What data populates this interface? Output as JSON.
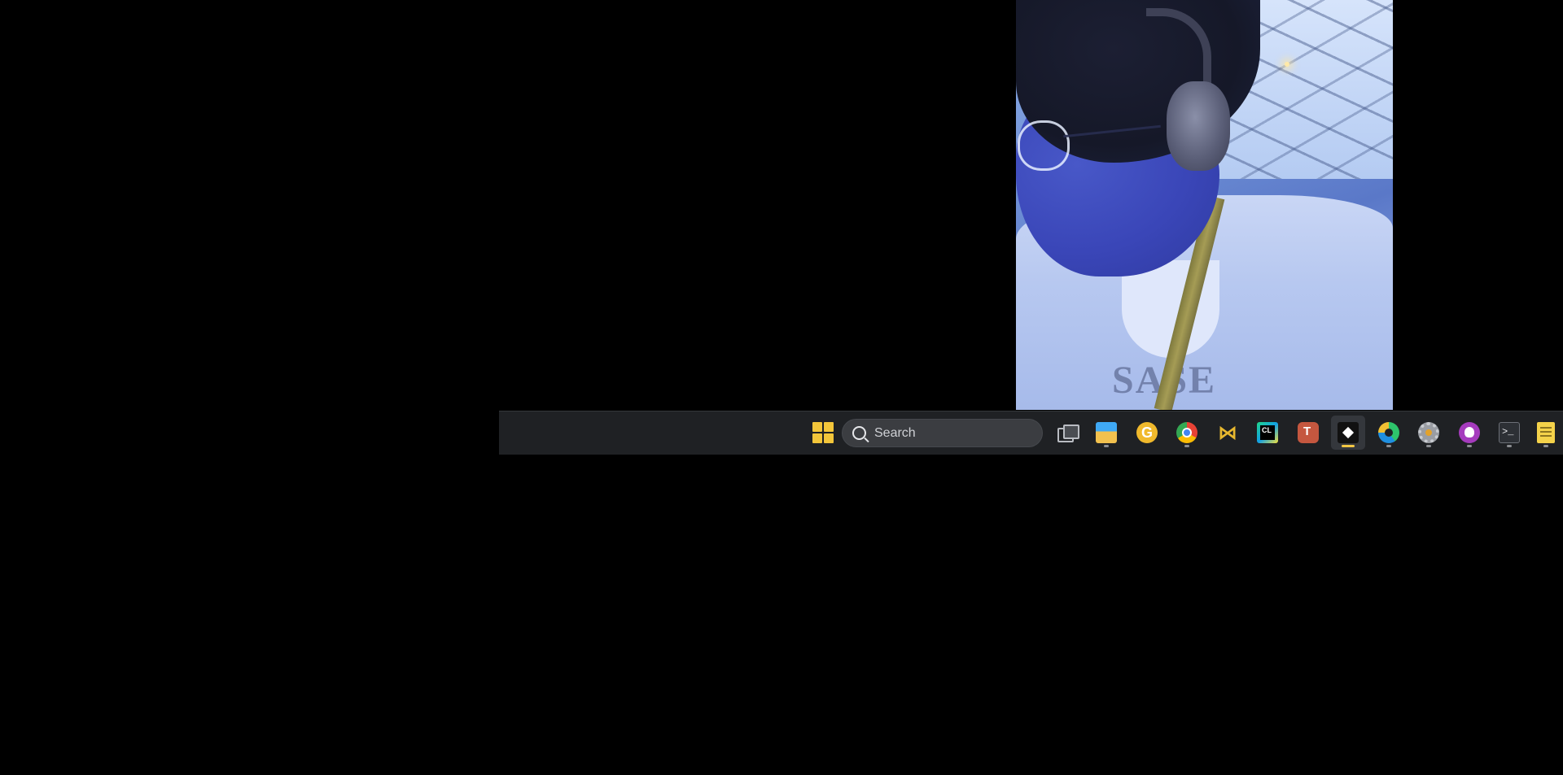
{
  "taskbar": {
    "search": {
      "placeholder": "Search"
    },
    "pinned": [
      {
        "name": "start",
        "icon": "windows-start-icon"
      },
      {
        "name": "task-view",
        "icon": "task-view-icon"
      },
      {
        "name": "file-explorer",
        "icon": "folder-icon",
        "running": true
      },
      {
        "name": "g-app",
        "icon": "g-icon"
      },
      {
        "name": "chrome",
        "icon": "chrome-icon",
        "running": true
      },
      {
        "name": "visual-studio",
        "icon": "visual-studio-icon"
      },
      {
        "name": "clion",
        "icon": "clion-icon"
      },
      {
        "name": "teams",
        "icon": "teams-icon"
      },
      {
        "name": "box-app",
        "icon": "box-icon",
        "running": true,
        "active": true
      },
      {
        "name": "edge",
        "icon": "edge-icon",
        "running": true
      },
      {
        "name": "settings",
        "icon": "gear-icon",
        "running": true
      },
      {
        "name": "github-desktop",
        "icon": "github-icon",
        "running": true
      },
      {
        "name": "terminal",
        "icon": "terminal-icon",
        "running": true
      },
      {
        "name": "notepad",
        "icon": "notepad-icon",
        "running": true
      }
    ],
    "terminal_glyph": ">_",
    "clion_glyph": "CL",
    "teams_glyph": "T",
    "g_glyph": "G",
    "vs_glyph": "⋈"
  },
  "webcam": {
    "shirt_text": "SASE"
  },
  "colors": {
    "desktop": "#000000",
    "taskbar": "#1f2124",
    "active_indicator": "#f2c744",
    "windows_logo": "#f3c63a"
  }
}
